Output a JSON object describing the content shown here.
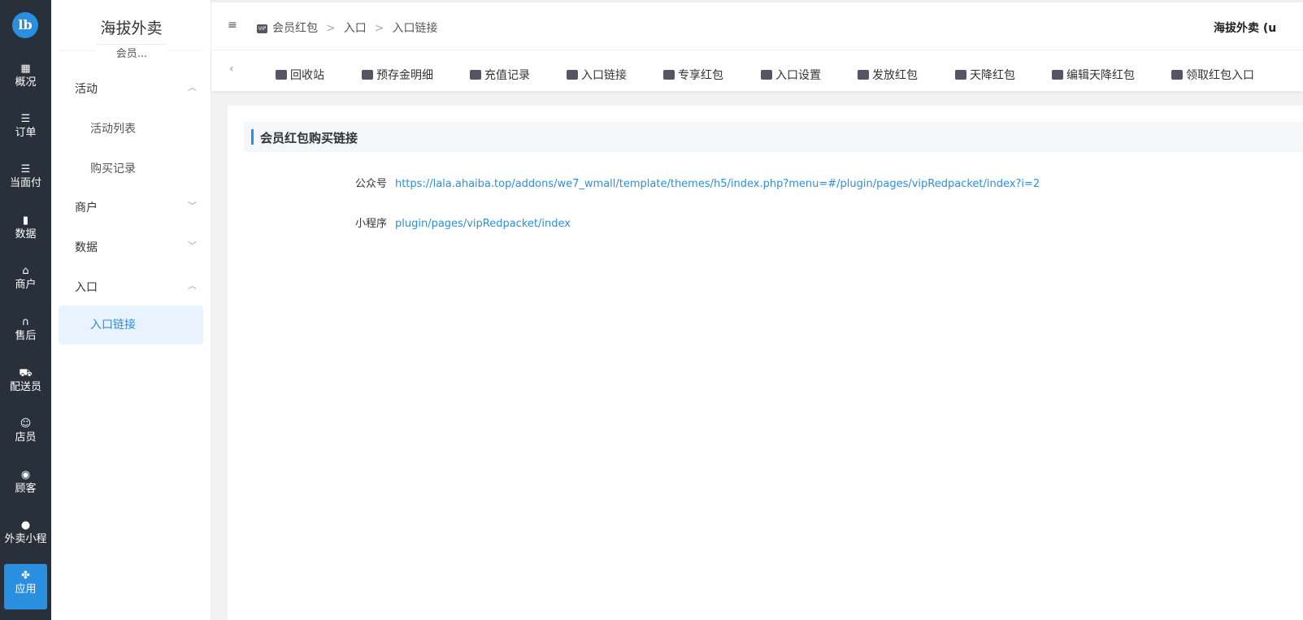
{
  "rail": {
    "logo": "lb",
    "items": [
      {
        "label": "概况",
        "icon": "grid-icon"
      },
      {
        "label": "订单",
        "icon": "list-icon"
      },
      {
        "label": "当面付",
        "icon": "list-icon"
      },
      {
        "label": "数据",
        "icon": "bar-chart-icon"
      },
      {
        "label": "商户",
        "icon": "store-icon"
      },
      {
        "label": "售后",
        "icon": "headset-icon"
      },
      {
        "label": "配送员",
        "icon": "truck-icon"
      },
      {
        "label": "店员",
        "icon": "users-icon"
      },
      {
        "label": "顾客",
        "icon": "user-circle-icon"
      },
      {
        "label": "外卖小程",
        "icon": "wechat-icon"
      },
      {
        "label": "应用",
        "icon": "apps-icon"
      }
    ]
  },
  "menu": {
    "title": "海拔外卖",
    "subtitle": "会员...",
    "groups": {
      "activity": "活动",
      "merchant": "商户",
      "data": "数据",
      "entry": "入口"
    },
    "items": {
      "activity_list": "活动列表",
      "purchase_record": "购买记录",
      "entry_link": "入口链接"
    }
  },
  "header": {
    "crumbs": [
      "会员红包",
      "入口",
      "入口链接"
    ],
    "separator": ">",
    "user": "海拔外卖 (u"
  },
  "tabs": [
    "回收站",
    "预存金明细",
    "充值记录",
    "入口链接",
    "专享红包",
    "入口设置",
    "发放红包",
    "天降红包",
    "编辑天降红包",
    "领取红包入口"
  ],
  "main": {
    "section_title": "会员红包购买链接",
    "rows": [
      {
        "key": "公众号",
        "value": "https://lala.ahaiba.top/addons/we7_wmall/template/themes/h5/index.php?menu=#/plugin/pages/vipRedpacket/index?i=2"
      },
      {
        "key": "小程序",
        "value": "plugin/pages/vipRedpacket/index"
      }
    ]
  },
  "colors": {
    "rail_bg": "#28303b",
    "accent": "#2b8fe0",
    "active_menu_bg": "#e8f3fd"
  }
}
